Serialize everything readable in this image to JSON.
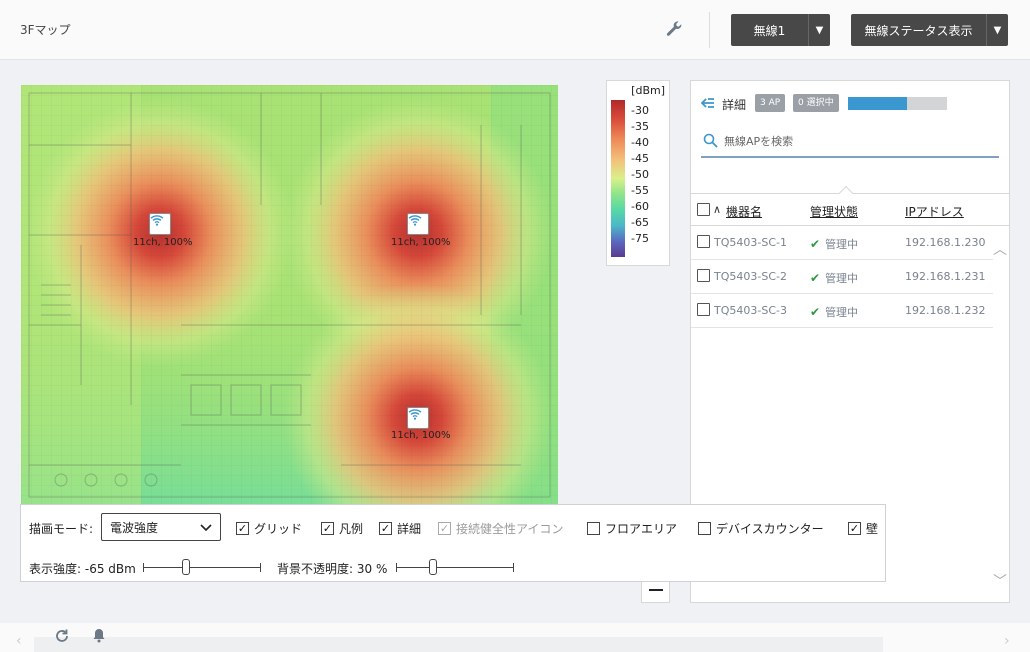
{
  "header": {
    "title": "3Fマップ",
    "wireless_select": "無線1",
    "status_select": "無線ステータス表示",
    "settings_icon": "wrench-icon",
    "caret": "▼"
  },
  "map": {
    "access_points": [
      {
        "label": "11ch, 100%"
      },
      {
        "label": "11ch, 100%"
      },
      {
        "label": "11ch, 100%"
      }
    ]
  },
  "legend": {
    "title": "[dBm]",
    "ticks": [
      "-30",
      "-35",
      "-40",
      "-45",
      "-50",
      "-55",
      "-60",
      "-65",
      "-75"
    ]
  },
  "detail": {
    "title": "詳細",
    "ap_count": "3 AP",
    "selected": "0 選択中",
    "progress": 0.6,
    "search_placeholder": "無線APを検索",
    "columns": {
      "name": "機器名",
      "status": "管理状態",
      "ip": "IPアドレス"
    },
    "sort_arrow": "∧",
    "devices": [
      {
        "name": "TQ5403-SC-1",
        "status": "管理中",
        "ip": "192.168.1.230"
      },
      {
        "name": "TQ5403-SC-2",
        "status": "管理中",
        "ip": "192.168.1.231"
      },
      {
        "name": "TQ5403-SC-3",
        "status": "管理中",
        "ip": "192.168.1.232"
      }
    ]
  },
  "controls": {
    "draw_mode_label": "描画モード:",
    "draw_mode_value": "電波強度",
    "checkboxes": {
      "grid": {
        "label": "グリッド",
        "checked": true
      },
      "legend": {
        "label": "凡例",
        "checked": true
      },
      "detail": {
        "label": "詳細",
        "checked": true
      },
      "health_icon": {
        "label": "接続健全性アイコン",
        "checked": true,
        "disabled": true
      },
      "floor_area": {
        "label": "フロアエリア",
        "checked": false
      },
      "device_counter": {
        "label": "デバイスカウンター",
        "checked": false
      },
      "wall": {
        "label": "壁",
        "checked": true
      }
    },
    "strength_label": "表示強度: -65 dBm",
    "opacity_label": "背景不透明度: 30 %",
    "strength_fraction": 0.35,
    "opacity_fraction": 0.3
  },
  "colors": {
    "accent": "#3b97cf",
    "header_button": "#484848",
    "managed_check": "#2e9a3e"
  }
}
